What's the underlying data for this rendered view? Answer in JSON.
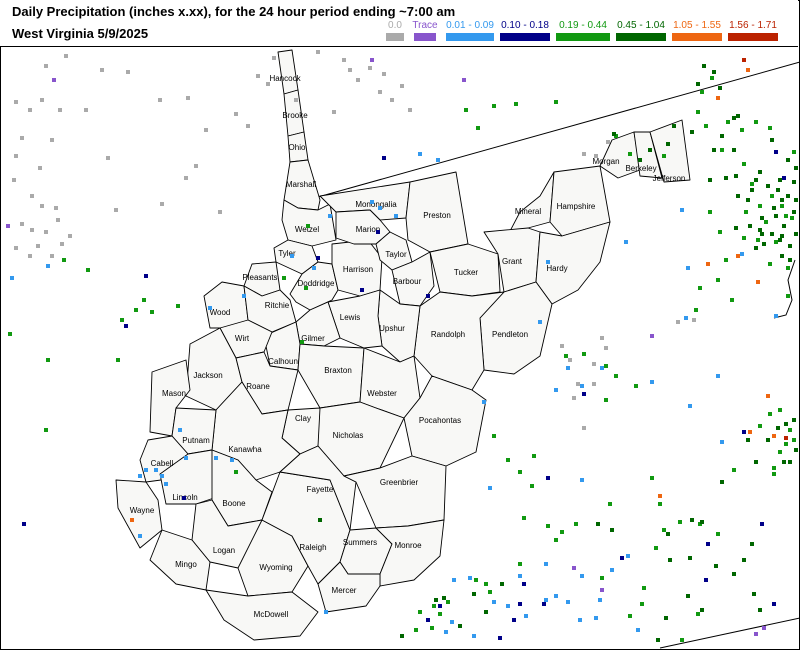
{
  "header": {
    "title_line1": "Daily Precipitation (inches  x.xx),  for the 24 hour period ending ~7:00 am",
    "title_line2": "West Virginia 5/9/2025"
  },
  "legend": [
    {
      "label": "0.0",
      "color": "#aaaaaa"
    },
    {
      "label": "Trace",
      "color": "#8855cc"
    },
    {
      "label": "0.01 - 0.09",
      "color": "#3399ee"
    },
    {
      "label": "0.10 - 0.18",
      "color": "#000088"
    },
    {
      "label": "0.19 - 0.44",
      "color": "#119911"
    },
    {
      "label": "0.45 - 1.04",
      "color": "#006600"
    },
    {
      "label": "1.05 - 1.55",
      "color": "#ee6611"
    },
    {
      "label": "1.56 - 1.71",
      "color": "#bb2200"
    }
  ],
  "counties": [
    {
      "name": "Hancock"
    },
    {
      "name": "Brooke"
    },
    {
      "name": "Ohio"
    },
    {
      "name": "Marshall"
    },
    {
      "name": "Wetzel"
    },
    {
      "name": "Tyler"
    },
    {
      "name": "Pleasants"
    },
    {
      "name": "Wood"
    },
    {
      "name": "Ritchie"
    },
    {
      "name": "Doddridge"
    },
    {
      "name": "Harrison"
    },
    {
      "name": "Monongalia"
    },
    {
      "name": "Marion"
    },
    {
      "name": "Preston"
    },
    {
      "name": "Taylor"
    },
    {
      "name": "Barbour"
    },
    {
      "name": "Tucker"
    },
    {
      "name": "Mineral"
    },
    {
      "name": "Hampshire"
    },
    {
      "name": "Morgan"
    },
    {
      "name": "Berkeley"
    },
    {
      "name": "Jefferson"
    },
    {
      "name": "Grant"
    },
    {
      "name": "Hardy"
    },
    {
      "name": "Pendleton"
    },
    {
      "name": "Randolph"
    },
    {
      "name": "Upshur"
    },
    {
      "name": "Lewis"
    },
    {
      "name": "Gilmer"
    },
    {
      "name": "Calhoun"
    },
    {
      "name": "Wirt"
    },
    {
      "name": "Jackson"
    },
    {
      "name": "Mason"
    },
    {
      "name": "Roane"
    },
    {
      "name": "Braxton"
    },
    {
      "name": "Webster"
    },
    {
      "name": "Pocahontas"
    },
    {
      "name": "Clay"
    },
    {
      "name": "Nicholas"
    },
    {
      "name": "Kanawha"
    },
    {
      "name": "Putnam"
    },
    {
      "name": "Cabell"
    },
    {
      "name": "Wayne"
    },
    {
      "name": "Lincoln"
    },
    {
      "name": "Boone"
    },
    {
      "name": "Logan"
    },
    {
      "name": "Mingo"
    },
    {
      "name": "Wyoming"
    },
    {
      "name": "McDowell"
    },
    {
      "name": "Raleigh"
    },
    {
      "name": "Fayette"
    },
    {
      "name": "Greenbrier"
    },
    {
      "name": "Summers"
    },
    {
      "name": "Monroe"
    },
    {
      "name": "Mercer"
    }
  ]
}
